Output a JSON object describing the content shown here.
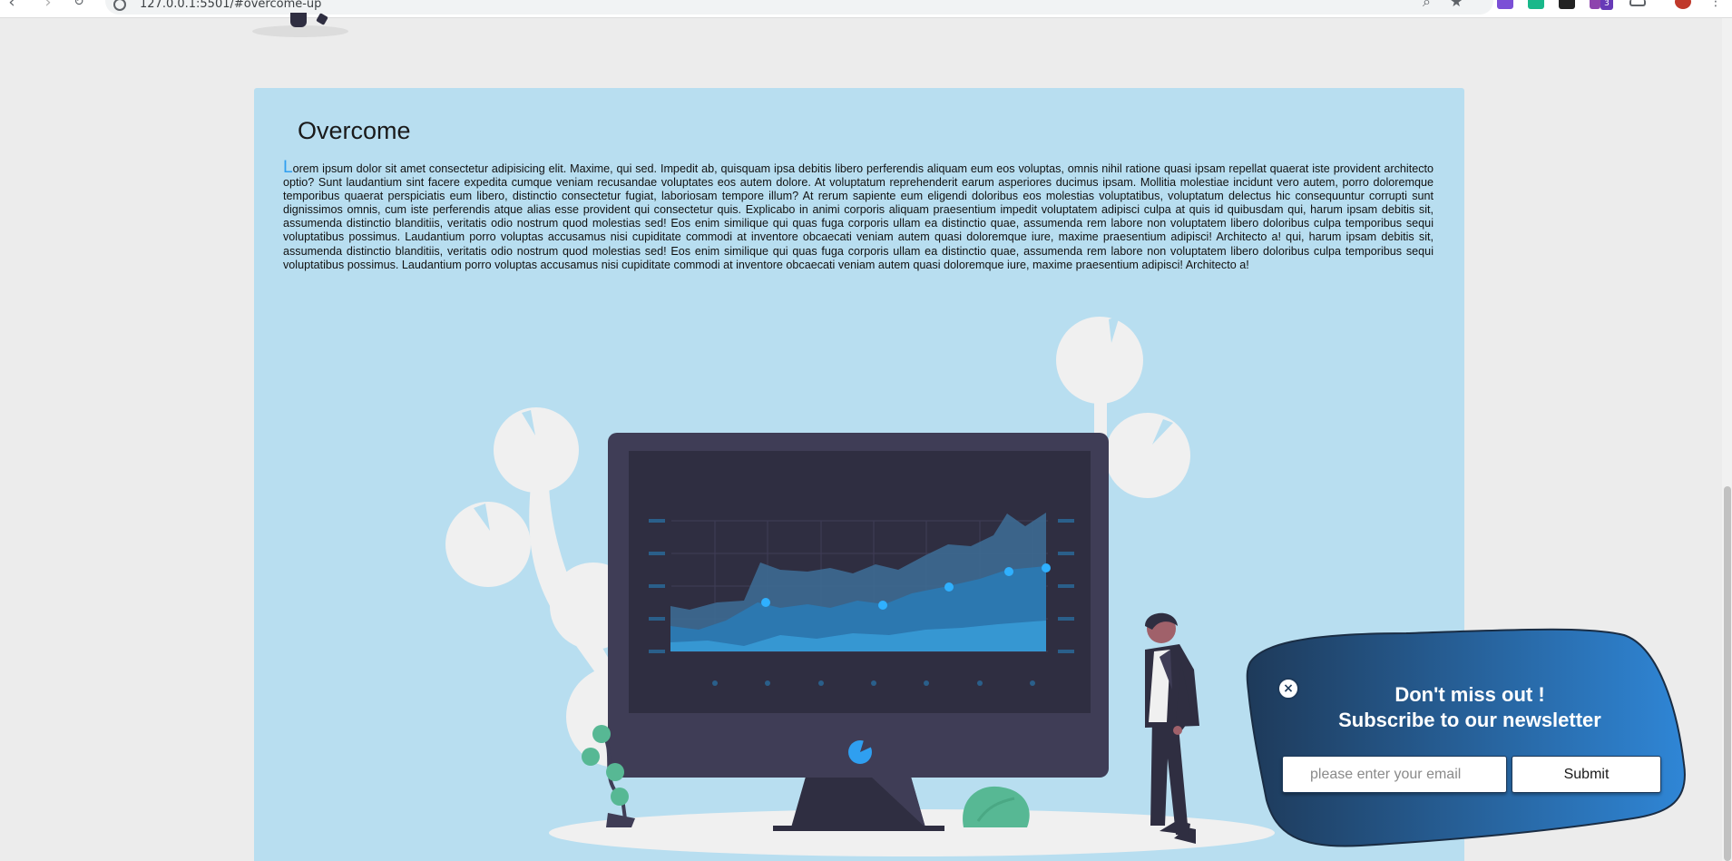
{
  "browser": {
    "url": "127.0.0.1:5501/#overcome-up",
    "extension_badge": "3"
  },
  "section": {
    "title": "Overcome",
    "drop_cap": "L",
    "body": "orem ipsum dolor sit amet consectetur adipisicing elit. Maxime, qui sed. Impedit ab, quisquam ipsa debitis libero perferendis aliquam eum eos voluptas, omnis nihil ratione quasi ipsam repellat quaerat iste provident architecto optio? Sunt laudantium sint facere expedita cumque veniam recusandae voluptates eos autem dolore. At voluptatum reprehenderit earum asperiores ducimus ipsam. Mollitia molestiae incidunt vero autem, porro doloremque temporibus quaerat perspiciatis eum libero, distinctio consectetur fugiat, laboriosam tempore illum? At rerum sapiente eum eligendi doloribus eos molestias voluptatibus, voluptatum delectus hic consequuntur corrupti sunt dignissimos omnis, cum iste perferendis atque alias esse provident qui consectetur quis. Explicabo in animi corporis aliquam praesentium impedit voluptatem adipisci culpa at quis id quibusdam qui, harum ipsam debitis sit, assumenda distinctio blanditiis, veritatis odio nostrum quod molestias sed! Eos enim similique qui quas fuga corporis ullam ea distinctio quae, assumenda rem labore non voluptatem libero doloribus culpa temporibus sequi voluptatibus possimus. Laudantium porro voluptas accusamus nisi cupiditate commodi at inventore obcaecati veniam autem quasi doloremque iure, maxime praesentium adipisci! Architecto a! qui, harum ipsam debitis sit, assumenda distinctio blanditiis, veritatis odio nostrum quod molestias sed! Eos enim similique qui quas fuga corporis ullam ea distinctio quae, assumenda rem labore non voluptatem libero doloribus culpa temporibus sequi voluptatibus possimus. Laudantium porro voluptas accusamus nisi cupiditate commodi at inventore obcaecati veniam autem quasi doloremque iure, maxime praesentium adipisci! Architecto a!"
  },
  "newsletter": {
    "close_icon": "×",
    "heading_line1": "Don't miss out !",
    "heading_line2": "Subscribe to our newsletter",
    "email_placeholder": "please enter your email",
    "submit_label": "Submit"
  },
  "colors": {
    "section_bg": "#b8def0",
    "accent": "#2f9ff0",
    "monitor": "#3f3d56",
    "screen": "#2f2e41",
    "popup_dark": "#1e3a5a",
    "popup_light": "#2f80d0"
  },
  "icons": {
    "back": "arrow-left-icon",
    "forward": "arrow-right-icon",
    "reload": "reload-icon",
    "site_info": "site-info-icon",
    "zoom": "magnifier-icon",
    "bookmark": "star-icon",
    "close": "close-circle-icon"
  }
}
